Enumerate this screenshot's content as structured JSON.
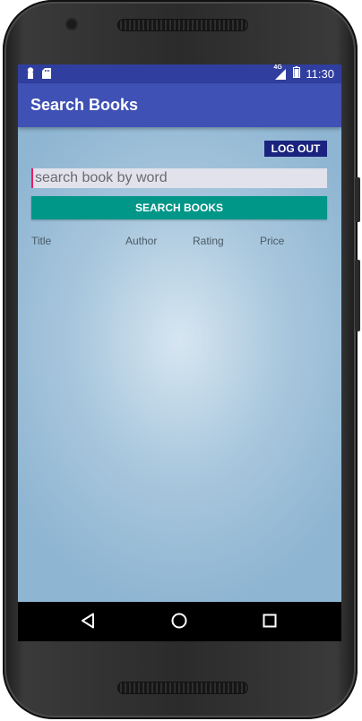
{
  "status_bar": {
    "network": "4G",
    "time": "11:30",
    "left_icons": [
      "notification-icon",
      "sd-card-icon"
    ]
  },
  "app_bar": {
    "title": "Search Books"
  },
  "main": {
    "logout_label": "LOG OUT",
    "search": {
      "value": "",
      "placeholder": "search book by word"
    },
    "search_button_label": "SEARCH BOOKS",
    "columns": [
      "Title",
      "Author",
      "Rating",
      "Price"
    ]
  },
  "nav_bar": {
    "items": [
      "back-icon",
      "home-icon",
      "recents-icon"
    ]
  },
  "colors": {
    "status_bar": "#303f9f",
    "app_bar": "#3f51b5",
    "logout_button": "#1a237e",
    "search_button": "#009688",
    "cursor": "#e91e63"
  }
}
